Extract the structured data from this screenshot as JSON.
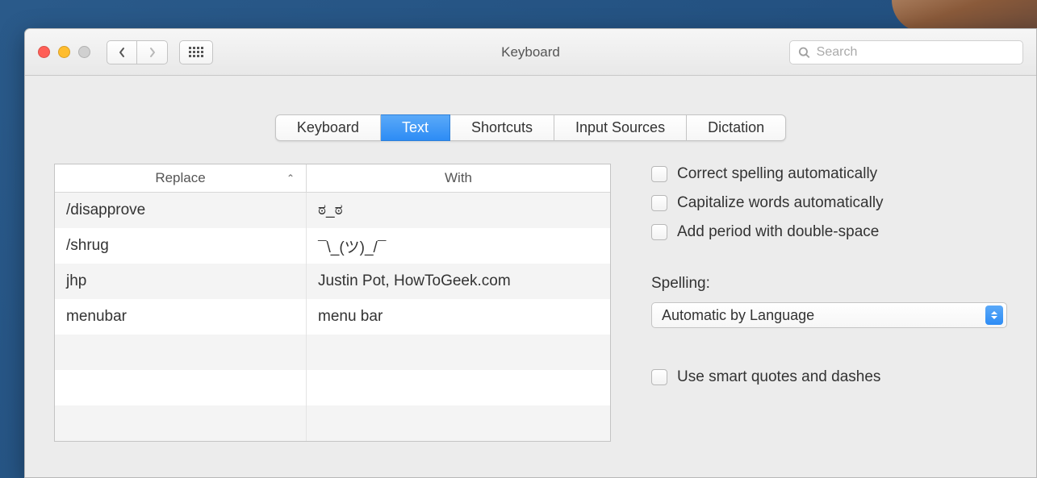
{
  "window": {
    "title": "Keyboard"
  },
  "search": {
    "placeholder": "Search"
  },
  "tabs": {
    "items": [
      "Keyboard",
      "Text",
      "Shortcuts",
      "Input Sources",
      "Dictation"
    ],
    "selected": "Text"
  },
  "table": {
    "headers": {
      "replace": "Replace",
      "with": "With"
    },
    "rows": [
      {
        "replace": "/disapprove",
        "with": "ಠ_ಠ"
      },
      {
        "replace": "/shrug",
        "with": "¯\\_(ツ)_/¯"
      },
      {
        "replace": "jhp",
        "with": "Justin Pot, HowToGeek.com"
      },
      {
        "replace": "menubar",
        "with": "menu bar"
      }
    ],
    "empty_rows": 3
  },
  "options": {
    "correct_spelling": "Correct spelling automatically",
    "capitalize_words": "Capitalize words automatically",
    "add_period": "Add period with double-space",
    "spelling_label": "Spelling:",
    "spelling_value": "Automatic by Language",
    "smart_quotes": "Use smart quotes and dashes"
  }
}
